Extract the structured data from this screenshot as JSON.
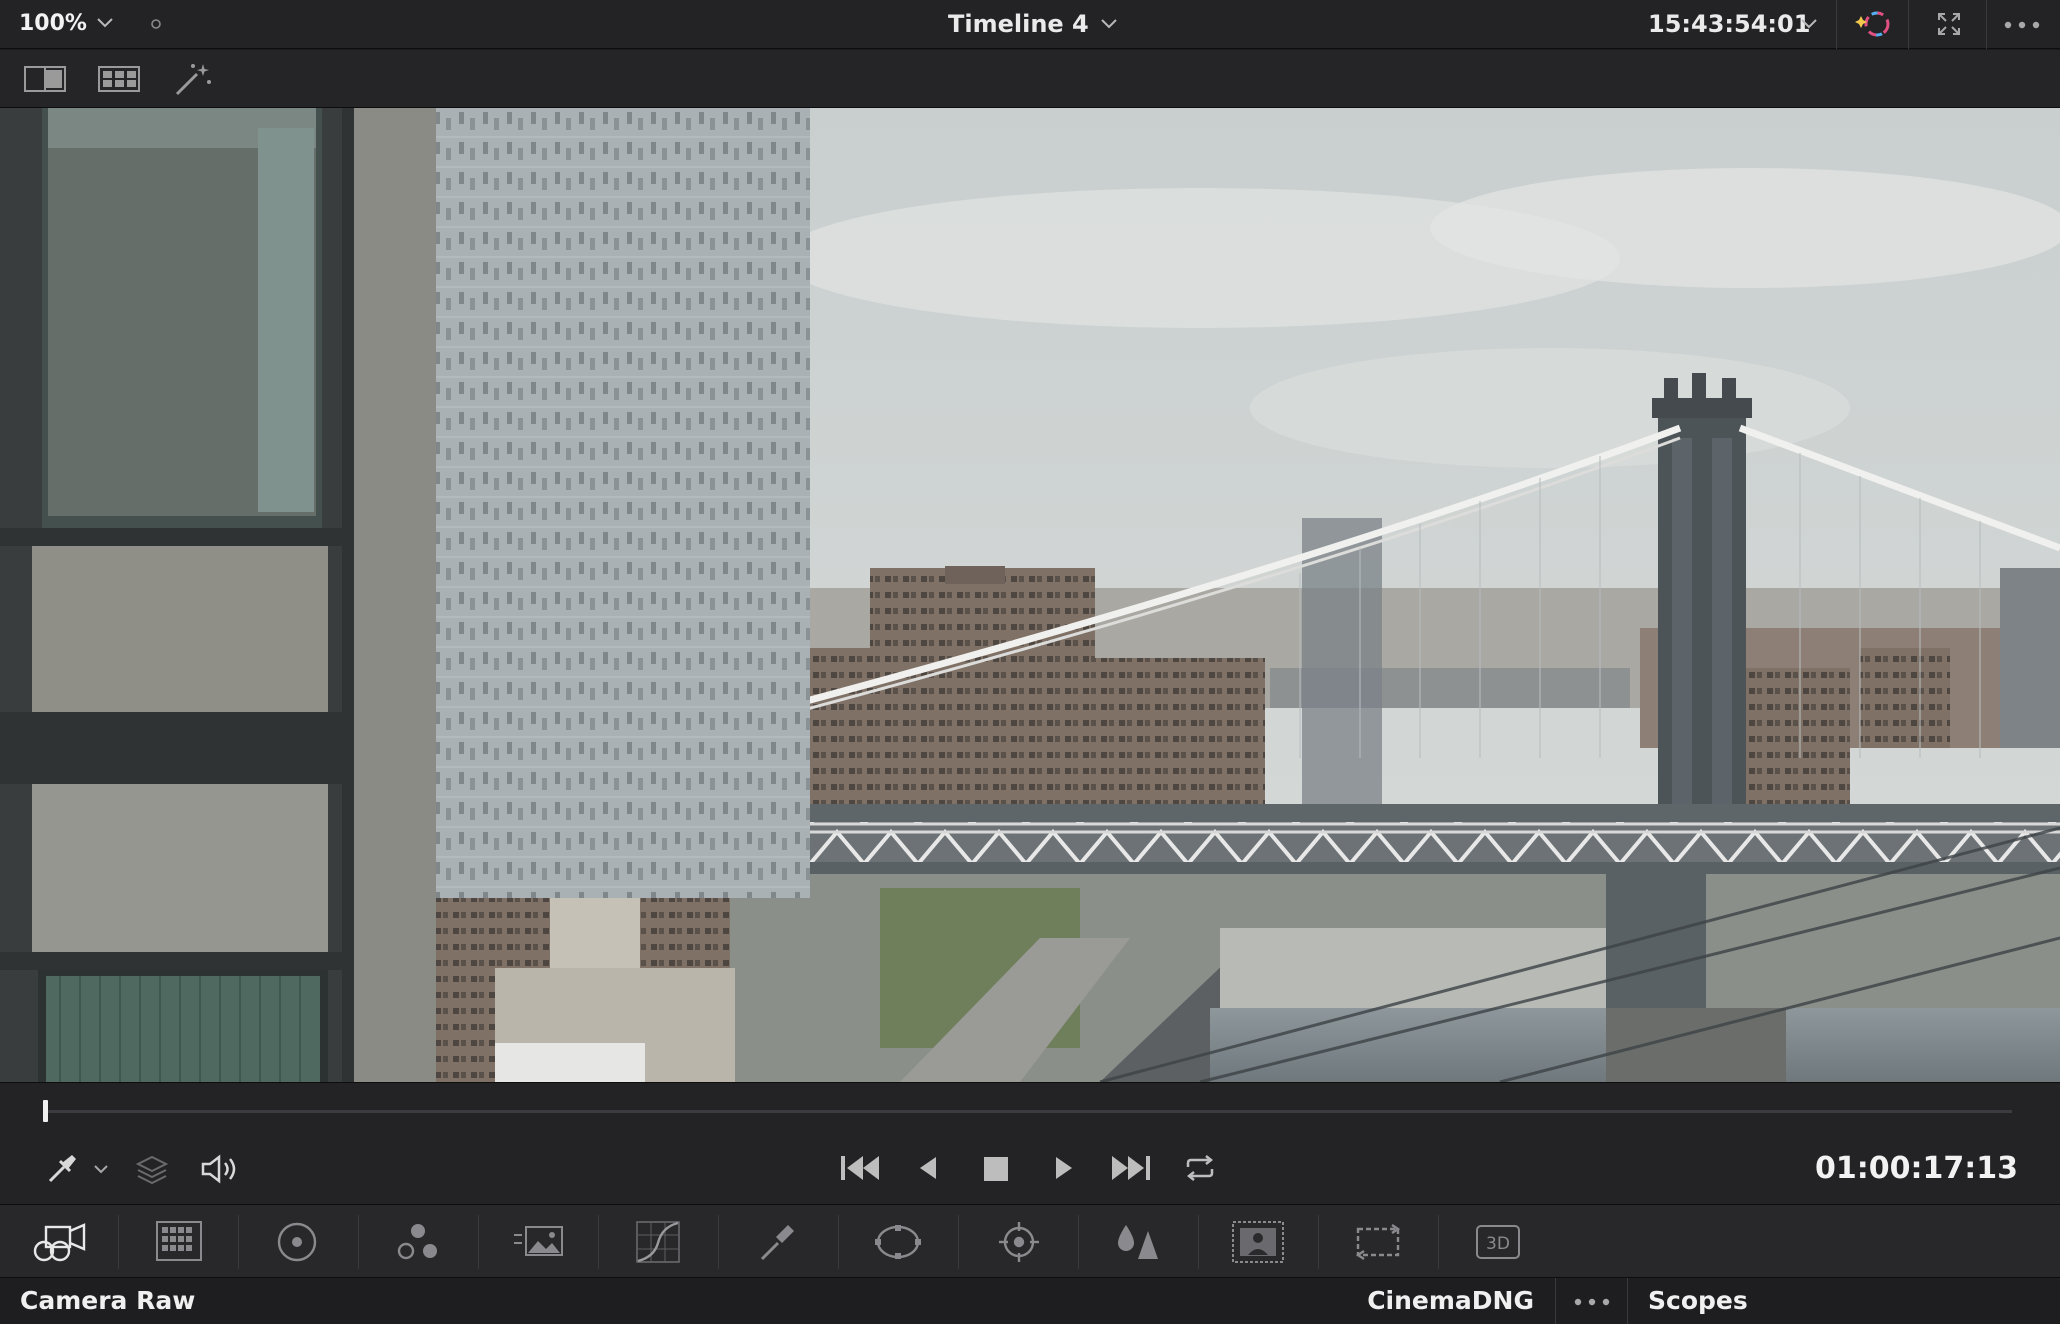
{
  "topbar": {
    "zoom_level": "100%",
    "timeline_title": "Timeline 4",
    "source_timecode": "15:43:54:01"
  },
  "transport": {
    "playhead_fraction": 0.0,
    "record_timecode": "01:00:17:13"
  },
  "palette": {
    "tools": [
      {
        "icon": "camera-raw-icon",
        "active": true
      },
      {
        "icon": "color-match-icon"
      },
      {
        "icon": "primaries-wheels-icon"
      },
      {
        "icon": "rgb-mixer-icon"
      },
      {
        "icon": "motion-effects-icon"
      },
      {
        "icon": "curves-icon"
      },
      {
        "icon": "qualifier-icon"
      },
      {
        "icon": "power-window-icon"
      },
      {
        "icon": "tracker-icon"
      },
      {
        "icon": "blur-icon"
      },
      {
        "icon": "key-icon"
      },
      {
        "icon": "sizing-icon"
      },
      {
        "icon": "stereo-3d-icon"
      }
    ],
    "stereo_label": "3D"
  },
  "status": {
    "panel_title": "Camera Raw",
    "decode_format": "CinemaDNG",
    "scopes_label": "Scopes"
  },
  "colors": {
    "accent": "#f0f0f0",
    "panel_bg": "#232326",
    "viewer_bg": "#0f0f10"
  }
}
